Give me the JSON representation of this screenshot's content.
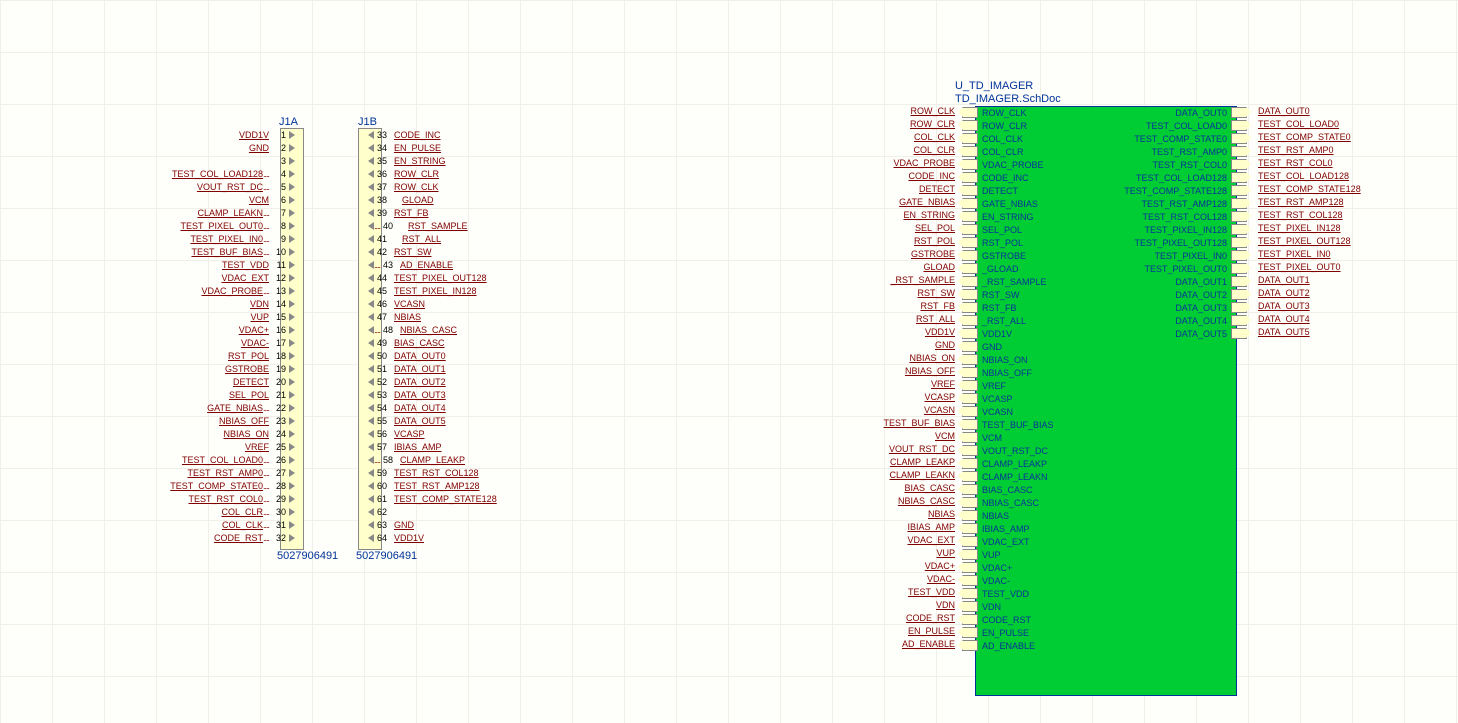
{
  "connectors": {
    "j1a": {
      "designator": "J1A",
      "part": "5027906491",
      "pins": [
        {
          "num": "1",
          "net": "VDD1V"
        },
        {
          "num": "2",
          "net": "GND"
        },
        {
          "num": "3",
          "net": ""
        },
        {
          "num": "4",
          "net": "TEST_COL_LOAD128",
          "dotted": true
        },
        {
          "num": "5",
          "net": "VOUT_RST_DC",
          "dotted": true
        },
        {
          "num": "6",
          "net": "VCM"
        },
        {
          "num": "7",
          "net": "CLAMP_LEAKN",
          "dotted": true
        },
        {
          "num": "8",
          "net": "TEST_PIXEL_OUT0",
          "dotted": true
        },
        {
          "num": "9",
          "net": "TEST_PIXEL_IN0",
          "dotted": true
        },
        {
          "num": "10",
          "net": "TEST_BUF_BIAS",
          "dotted": true
        },
        {
          "num": "11",
          "net": "TEST_VDD"
        },
        {
          "num": "12",
          "net": "VDAC_EXT"
        },
        {
          "num": "13",
          "net": "VDAC_PROBE",
          "dotted": true
        },
        {
          "num": "14",
          "net": "VDN"
        },
        {
          "num": "15",
          "net": "VUP"
        },
        {
          "num": "16",
          "net": "VDAC+"
        },
        {
          "num": "17",
          "net": "VDAC-"
        },
        {
          "num": "18",
          "net": "RST_POL"
        },
        {
          "num": "19",
          "net": "GSTROBE"
        },
        {
          "num": "20",
          "net": "DETECT"
        },
        {
          "num": "21",
          "net": "SEL_POL"
        },
        {
          "num": "22",
          "net": "GATE_NBIAS",
          "dotted": true
        },
        {
          "num": "23",
          "net": "NBIAS_OFF"
        },
        {
          "num": "24",
          "net": "NBIAS_ON"
        },
        {
          "num": "25",
          "net": "VREF"
        },
        {
          "num": "26",
          "net": "TEST_COL_LOAD0",
          "dotted": true
        },
        {
          "num": "27",
          "net": "TEST_RST_AMP0",
          "dotted": true
        },
        {
          "num": "28",
          "net": "TEST_COMP_STATE0",
          "dotted": true
        },
        {
          "num": "29",
          "net": "TEST_RST_COL0",
          "dotted": true
        },
        {
          "num": "30",
          "net": "COL_CLR",
          "dotted": true
        },
        {
          "num": "31",
          "net": "COL_CLK",
          "dotted": true
        },
        {
          "num": "32",
          "net": "CODE_RST",
          "dotted": true
        }
      ]
    },
    "j1b": {
      "designator": "J1B",
      "part": "5027906491",
      "pins": [
        {
          "num": "33",
          "net": "CODE_INC"
        },
        {
          "num": "34",
          "net": "EN_PULSE"
        },
        {
          "num": "35",
          "net": "EN_STRING"
        },
        {
          "num": "36",
          "net": "ROW_CLR"
        },
        {
          "num": "37",
          "net": "ROW_CLK"
        },
        {
          "num": "38",
          "net": "GLOAD",
          "lead": true
        },
        {
          "num": "39",
          "net": "RST_FB"
        },
        {
          "num": "40",
          "net": "RST_SAMPLE",
          "lead": true,
          "dotted": true
        },
        {
          "num": "41",
          "net": "RST_ALL",
          "lead": true
        },
        {
          "num": "42",
          "net": "RST_SW"
        },
        {
          "num": "43",
          "net": "AD_ENABLE",
          "dotted": true
        },
        {
          "num": "44",
          "net": "TEST_PIXEL_OUT128"
        },
        {
          "num": "45",
          "net": "TEST_PIXEL_IN128"
        },
        {
          "num": "46",
          "net": "VCASN"
        },
        {
          "num": "47",
          "net": "NBIAS"
        },
        {
          "num": "48",
          "net": "NBIAS_CASC",
          "dotted": true
        },
        {
          "num": "49",
          "net": "BIAS_CASC"
        },
        {
          "num": "50",
          "net": "DATA_OUT0"
        },
        {
          "num": "51",
          "net": "DATA_OUT1"
        },
        {
          "num": "52",
          "net": "DATA_OUT2"
        },
        {
          "num": "53",
          "net": "DATA_OUT3"
        },
        {
          "num": "54",
          "net": "DATA_OUT4"
        },
        {
          "num": "55",
          "net": "DATA_OUT5"
        },
        {
          "num": "56",
          "net": "VCASP"
        },
        {
          "num": "57",
          "net": "IBIAS_AMP"
        },
        {
          "num": "58",
          "net": "CLAMP_LEAKP",
          "dotted": true
        },
        {
          "num": "59",
          "net": "TEST_RST_COL128"
        },
        {
          "num": "60",
          "net": "TEST_RST_AMP128"
        },
        {
          "num": "61",
          "net": "TEST_COMP_STATE128"
        },
        {
          "num": "62",
          "net": ""
        },
        {
          "num": "63",
          "net": "GND"
        },
        {
          "num": "64",
          "net": "VDD1V"
        }
      ]
    }
  },
  "sheet": {
    "title": "U_TD_IMAGER",
    "file": "TD_IMAGER.SchDoc",
    "left_ports": [
      "ROW_CLK",
      "ROW_CLR",
      "COL_CLK",
      "COL_CLR",
      "VDAC_PROBE",
      "CODE_INC",
      "DETECT",
      "GATE_NBIAS",
      "EN_STRING",
      "SEL_POL",
      "RST_POL",
      "GSTROBE",
      "_GLOAD",
      "_RST_SAMPLE",
      "RST_SW",
      "RST_FB",
      "_RST_ALL",
      "VDD1V",
      "GND",
      "NBIAS_ON",
      "NBIAS_OFF",
      "VREF",
      "VCASP",
      "VCASN",
      "TEST_BUF_BIAS",
      "VCM",
      "VOUT_RST_DC",
      "CLAMP_LEAKP",
      "CLAMP_LEAKN",
      "BIAS_CASC",
      "NBIAS_CASC",
      "NBIAS",
      "IBIAS_AMP",
      "VDAC_EXT",
      "VUP",
      "VDAC+",
      "VDAC-",
      "TEST_VDD",
      "VDN",
      "CODE_RST",
      "EN_PULSE",
      "AD_ENABLE"
    ],
    "left_nets": [
      "ROW_CLK",
      "ROW_CLR",
      "COL_CLK",
      "COL_CLR",
      "VDAC_PROBE",
      "CODE_INC",
      "DETECT",
      "GATE_NBIAS",
      "EN_STRING",
      "SEL_POL",
      "RST_POL",
      "GSTROBE",
      "GLOAD",
      "_RST_SAMPLE",
      "RST_SW",
      "RST_FB",
      "RST_ALL",
      "VDD1V",
      "GND",
      "NBIAS_ON",
      "NBIAS_OFF",
      "VREF",
      "VCASP",
      "VCASN",
      "TEST_BUF_BIAS",
      "VCM",
      "VOUT_RST_DC",
      "CLAMP_LEAKP",
      "CLAMP_LEAKN",
      "BIAS_CASC",
      "NBIAS_CASC",
      "NBIAS",
      "IBIAS_AMP",
      "VDAC_EXT",
      "VUP",
      "VDAC+",
      "VDAC-",
      "TEST_VDD",
      "VDN",
      "CODE_RST",
      "EN_PULSE",
      "AD_ENABLE"
    ],
    "right_ports": [
      "DATA_OUT0",
      "TEST_COL_LOAD0",
      "TEST_COMP_STATE0",
      "TEST_RST_AMP0",
      "TEST_RST_COL0",
      "TEST_COL_LOAD128",
      "TEST_COMP_STATE128",
      "TEST_RST_AMP128",
      "TEST_RST_COL128",
      "TEST_PIXEL_IN128",
      "TEST_PIXEL_OUT128",
      "TEST_PIXEL_IN0",
      "TEST_PIXEL_OUT0",
      "DATA_OUT1",
      "DATA_OUT2",
      "DATA_OUT3",
      "DATA_OUT4",
      "DATA_OUT5"
    ],
    "right_nets": [
      "DATA_OUT0",
      "TEST_COL_LOAD0",
      "TEST_COMP_STATE0",
      "TEST_RST_AMP0",
      "TEST_RST_COL0",
      "TEST_COL_LOAD128",
      "TEST_COMP_STATE128",
      "TEST_RST_AMP128",
      "TEST_RST_COL128",
      "TEST_PIXEL_IN128",
      "TEST_PIXEL_OUT128",
      "TEST_PIXEL_IN0",
      "TEST_PIXEL_OUT0",
      "DATA_OUT1",
      "DATA_OUT2",
      "DATA_OUT3",
      "DATA_OUT4",
      "DATA_OUT5"
    ]
  }
}
